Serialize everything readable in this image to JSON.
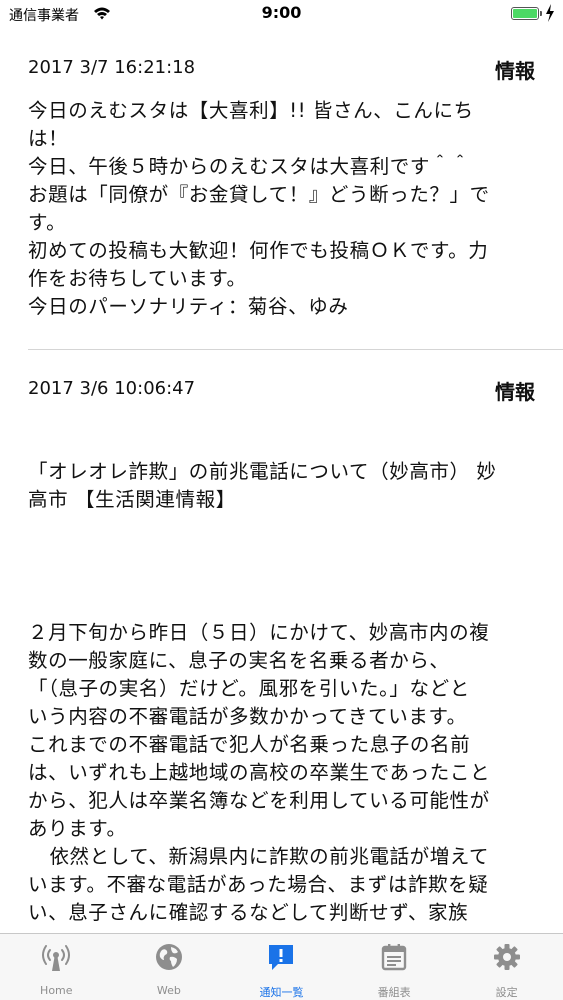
{
  "status_bar": {
    "carrier": "通信事業者",
    "time": "9:00"
  },
  "feed": {
    "items": [
      {
        "date": "2017 3/7 16:21:18",
        "tag": "情報",
        "lines": [
          "今日のえむスタは【大喜利】!! 皆さん、こんにち",
          "は！",
          "今日、午後５時からのえむスタは大喜利です＾＾",
          "お題は「同僚が『お金貸して！』どう断った？」で",
          "す。",
          "初めての投稿も大歓迎！何作でも投稿ＯＫです。力",
          "作をお待ちしています。",
          "今日のパーソナリティ：菊谷、ゆみ"
        ]
      },
      {
        "date": "2017 3/6 10:06:47",
        "tag": "情報",
        "headline_lines": [
          "「オレオレ詐欺」の前兆電話について（妙高市） 妙",
          "高市 【生活関連情報】"
        ],
        "body_lines": [
          "２月下旬から昨日（５日）にかけて、妙高市内の複",
          "数の一般家庭に、息子の実名を名乗る者から、",
          "「（息子の実名）だけど。風邪を引いた。」などと",
          "いう内容の不審電話が多数かかってきています。",
          "これまでの不審電話で犯人が名乗った息子の名前",
          "は、いずれも上越地域の高校の卒業生であったこと",
          "から、犯人は卒業名簿などを利用している可能性が",
          "あります。",
          "依然として、新潟県内に詐欺の前兆電話が増えて",
          "います。不審な電話があった場合、まずは詐欺を疑",
          "い、息子さんに確認するなどして判断せず、家族"
        ]
      }
    ]
  },
  "tab_bar": {
    "tabs": [
      {
        "label": "Home",
        "icon": "antenna-icon"
      },
      {
        "label": "Web",
        "icon": "globe-icon"
      },
      {
        "label": "通知一覧",
        "icon": "notice-icon",
        "active": true
      },
      {
        "label": "番組表",
        "icon": "calendar-icon"
      },
      {
        "label": "設定",
        "icon": "gear-icon"
      }
    ]
  },
  "colors": {
    "accent": "#1a73e8",
    "inactive": "#8e8e8e",
    "battery": "#4cd964",
    "tab_bar_bg": "#f7f7f7"
  }
}
